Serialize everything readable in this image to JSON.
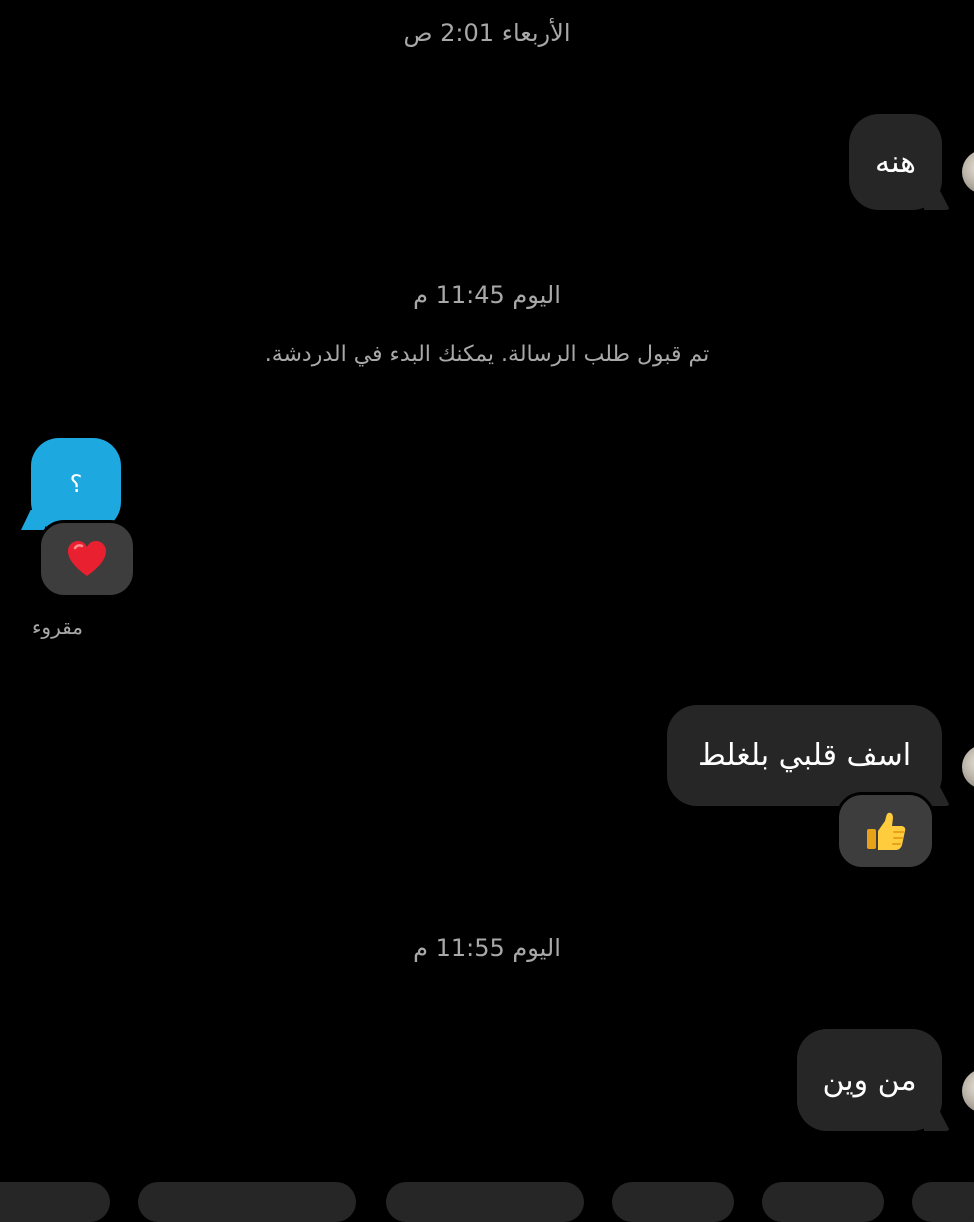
{
  "thread": {
    "timestamp_1": "الأربعاء 2:01 ص",
    "timestamp_2": "اليوم 11:45 م",
    "timestamp_3": "اليوم 11:55 م",
    "system_notice": "تم قبول طلب الرسالة. يمكنك البدء في الدردشة.",
    "seen_label": "مقروء"
  },
  "messages": [
    {
      "side": "incoming",
      "text": "هنه"
    },
    {
      "side": "outgoing",
      "text": "؟",
      "reaction": "❤️"
    },
    {
      "side": "incoming",
      "text": "اسف قلبي بلغلط",
      "reaction": "👍"
    },
    {
      "side": "incoming",
      "text": "من وين"
    }
  ],
  "colors": {
    "background": "#000000",
    "incoming_bubble": "#262626",
    "outgoing_bubble": "#1ea8e0",
    "meta_text": "#a8a8a8",
    "reaction_pill": "#3d3d3d"
  },
  "icons": {
    "heart_reaction": "heart-icon",
    "thumbs_up_reaction": "thumbs-up-icon",
    "contact_avatar": "avatar"
  }
}
